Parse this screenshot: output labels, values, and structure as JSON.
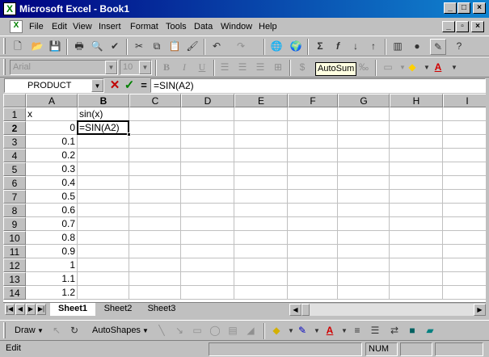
{
  "window": {
    "title": "Microsoft Excel - Book1",
    "min_label": "_",
    "max_label": "□",
    "close_label": "×",
    "doc_min_label": "_",
    "doc_restore_label": "▫",
    "doc_close_label": "×"
  },
  "menu": [
    "File",
    "Edit",
    "View",
    "Insert",
    "Format",
    "Tools",
    "Data",
    "Window",
    "Help"
  ],
  "formatting": {
    "font": "Arial",
    "size": "10",
    "bold": "B",
    "italic": "I",
    "underline": "U"
  },
  "tooltip": "AutoSum",
  "formula_bar": {
    "name_box": "PRODUCT",
    "cancel": "✕",
    "enter": "✓",
    "equals": "=",
    "formula": "=SIN(A2)"
  },
  "grid": {
    "columns": [
      "A",
      "B",
      "C",
      "D",
      "E",
      "F",
      "G",
      "H",
      "I"
    ],
    "rows": [
      "1",
      "2",
      "3",
      "4",
      "5",
      "6",
      "7",
      "8",
      "9",
      "10",
      "11",
      "12",
      "13",
      "14"
    ],
    "col_a": [
      "x",
      "0",
      "0.1",
      "0.2",
      "0.3",
      "0.4",
      "0.5",
      "0.6",
      "0.7",
      "0.8",
      "0.9",
      "1",
      "1.1",
      "1.2"
    ],
    "col_b": [
      "sin(x)",
      "=SIN(A2)"
    ],
    "active_cell": "B2"
  },
  "sheets": [
    "Sheet1",
    "Sheet2",
    "Sheet3"
  ],
  "drawing": {
    "draw": "Draw",
    "autoshapes": "AutoShapes"
  },
  "status": {
    "mode": "Edit",
    "num": "NUM"
  }
}
